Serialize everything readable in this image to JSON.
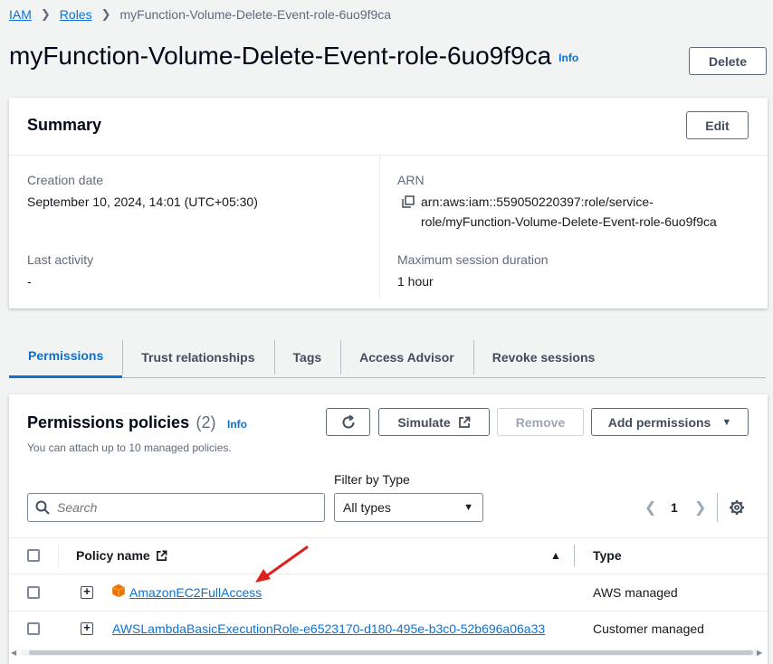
{
  "breadcrumb": {
    "items": [
      "IAM",
      "Roles"
    ],
    "current": "myFunction-Volume-Delete-Event-role-6uo9f9ca"
  },
  "page": {
    "title": "myFunction-Volume-Delete-Event-role-6uo9f9ca",
    "info": "Info",
    "delete_label": "Delete"
  },
  "summary": {
    "title": "Summary",
    "edit_label": "Edit",
    "creation_date_label": "Creation date",
    "creation_date": "September 10, 2024, 14:01 (UTC+05:30)",
    "last_activity_label": "Last activity",
    "last_activity": "-",
    "arn_label": "ARN",
    "arn_line1": "arn:aws:iam::559050220397:role/service-",
    "arn_line2": "role/myFunction-Volume-Delete-Event-role-6uo9f9ca",
    "max_session_label": "Maximum session duration",
    "max_session": "1 hour"
  },
  "tabs": [
    "Permissions",
    "Trust relationships",
    "Tags",
    "Access Advisor",
    "Revoke sessions"
  ],
  "policies": {
    "title": "Permissions policies",
    "count": "(2)",
    "info": "Info",
    "subtitle": "You can attach up to 10 managed policies.",
    "simulate_label": "Simulate",
    "remove_label": "Remove",
    "add_label": "Add permissions",
    "filter_label": "Filter by Type",
    "search_placeholder": "Search",
    "filter_value": "All types",
    "page": "1",
    "col_name": "Policy name",
    "col_type": "Type",
    "rows": [
      {
        "name": "AmazonEC2FullAccess",
        "type": "AWS managed"
      },
      {
        "name": "AWSLambdaBasicExecutionRole-e6523170-d180-495e-b3c0-52b696a06a33",
        "type": "Customer managed"
      }
    ]
  },
  "colors": {
    "link": "#0972d3",
    "annotation_arrow": "#e0201b",
    "aws_icon": "#ed7100"
  }
}
